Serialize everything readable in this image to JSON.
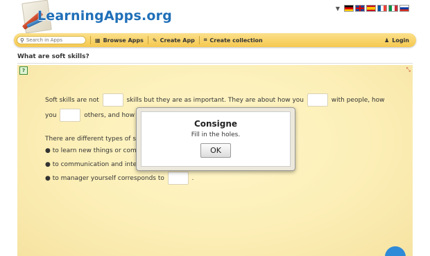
{
  "header": {
    "logo_text": "LearningApps.org",
    "languages": [
      "de",
      "en",
      "es",
      "fr",
      "it",
      "ru"
    ]
  },
  "nav": {
    "search_placeholder": "Search in Apps",
    "browse_label": "Browse Apps",
    "create_app_label": "Create App",
    "create_collection_label": "Create collection",
    "login_label": "Login"
  },
  "page": {
    "title": "What are soft skills?"
  },
  "exercise": {
    "line1_a": "Soft skills are not",
    "line1_b": "skills but they are as important. They are about how you",
    "line1_c": "with people, how",
    "line2_a": "you",
    "line2_b": "others, and how",
    "line3": "There are different types of s",
    "bullet1": "● to learn new things or comp",
    "bullet2": "● to communication and inter",
    "bullet3_a": "● to manager yourself corresponds to",
    "bullet3_b": "."
  },
  "modal": {
    "title": "Consigne",
    "text": "Fill in the holes.",
    "ok_label": "OK"
  },
  "colors": {
    "accent": "#1f6fb8",
    "navbar": "#f5c84e",
    "app_background": "#fcefb7"
  }
}
